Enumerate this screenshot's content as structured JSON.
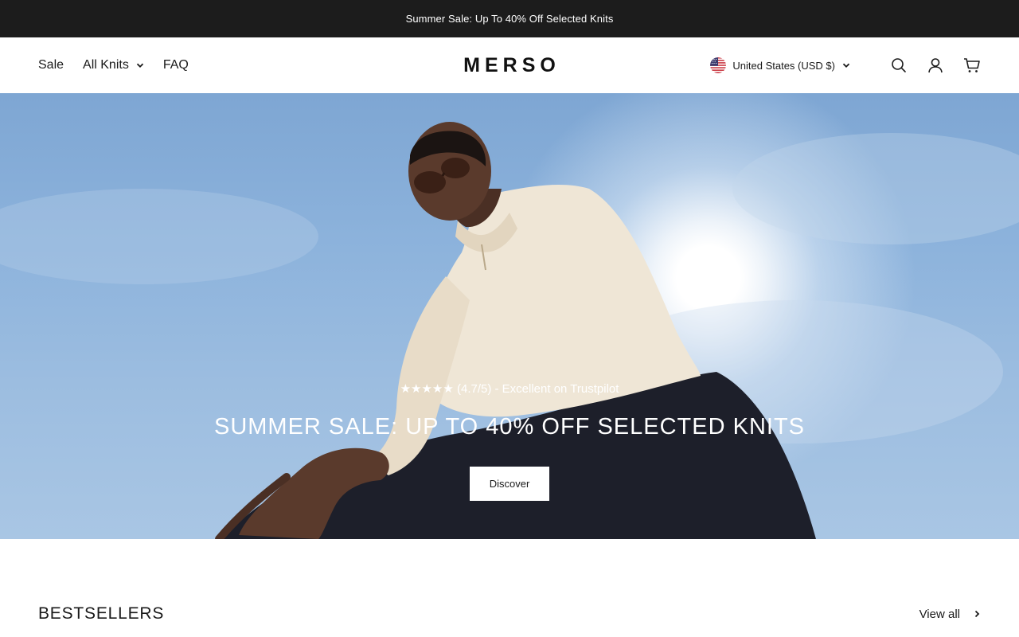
{
  "announcement": {
    "text": "Summer Sale: Up To 40% Off Selected Knits"
  },
  "header": {
    "nav": [
      {
        "label": "Sale",
        "has_dropdown": false
      },
      {
        "label": "All Knits",
        "has_dropdown": true
      },
      {
        "label": "FAQ",
        "has_dropdown": false
      }
    ],
    "logo": "MERSO",
    "country_selector": {
      "label": "United States (USD $)",
      "flag": "us-flag-icon"
    },
    "icons": [
      "search-icon",
      "account-icon",
      "cart-icon"
    ]
  },
  "hero": {
    "rating_text": "★★★★★ (4.7/5) - Excellent on Trustpilot",
    "title": "SUMMER SALE: UP TO 40% OFF SELECTED KNITS",
    "cta_label": "Discover"
  },
  "bestsellers": {
    "title": "BESTSELLERS",
    "view_all_label": "View all"
  },
  "colors": {
    "announcement_bg": "#1c1c1c",
    "sky": "#8db3dc",
    "sweater": "#efe6d6",
    "trousers": "#1d1f2a",
    "skin": "#5a3a2c"
  }
}
